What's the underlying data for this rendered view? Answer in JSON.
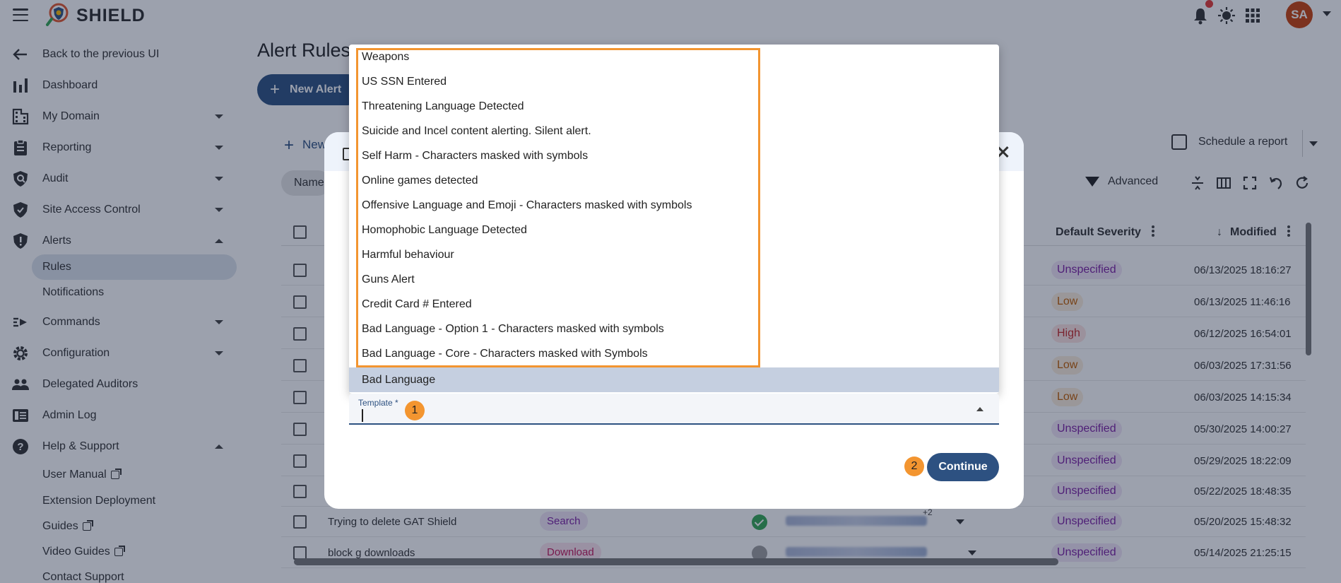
{
  "app": {
    "brand": "SHIELD"
  },
  "user": {
    "initials": "SA"
  },
  "colors": {
    "primary": "#2d5181",
    "accent": "#f39530",
    "avatar": "#c8410c"
  },
  "sidebar": {
    "back": "Back to the previous UI",
    "items": [
      {
        "label": "Dashboard",
        "icon": "bar-chart-icon"
      },
      {
        "label": "My Domain",
        "icon": "building-icon"
      },
      {
        "label": "Reporting",
        "icon": "clipboard-icon"
      },
      {
        "label": "Audit",
        "icon": "magnifier-icon"
      },
      {
        "label": "Site Access Control",
        "icon": "shield-icon"
      },
      {
        "label": "Alerts",
        "icon": "alert-shield-icon"
      },
      {
        "label": "Commands",
        "icon": "commands-icon"
      },
      {
        "label": "Configuration",
        "icon": "gear-icon"
      },
      {
        "label": "Delegated Auditors",
        "icon": "people-icon"
      },
      {
        "label": "Admin Log",
        "icon": "log-icon"
      },
      {
        "label": "Help & Support",
        "icon": "help-icon"
      }
    ],
    "alerts_sub": [
      "Rules",
      "Notifications"
    ],
    "help_sub": [
      "User Manual",
      "Extension Deployment",
      "Guides",
      "Video Guides",
      "Contact Support"
    ]
  },
  "main": {
    "title": "Alert Rules",
    "new_alert_button": "New Alert",
    "new_link": "New",
    "schedule_report": "Schedule a report",
    "filter_chip": "Name",
    "advanced": "Advanced",
    "columns": {
      "severity": "Default Severity",
      "modified": "Modified"
    },
    "rows": [
      {
        "name": "",
        "type": "",
        "severity": "Unspecified",
        "modified": "06/13/2025 18:16:27"
      },
      {
        "name": "",
        "type": "",
        "severity": "Low",
        "modified": "06/13/2025 11:46:16"
      },
      {
        "name": "",
        "type": "",
        "severity": "High",
        "modified": "06/12/2025 16:54:01"
      },
      {
        "name": "",
        "type": "",
        "severity": "Low",
        "modified": "06/03/2025 17:31:56"
      },
      {
        "name": "",
        "type": "",
        "severity": "Low",
        "modified": "06/03/2025 14:15:34"
      },
      {
        "name": "",
        "type": "",
        "severity": "Unspecified",
        "modified": "05/30/2025 14:00:27"
      },
      {
        "name": "",
        "type": "",
        "severity": "Unspecified",
        "modified": "05/29/2025 18:22:09"
      },
      {
        "name": "",
        "type": "",
        "severity": "Unspecified",
        "modified": "05/22/2025 18:48:35"
      },
      {
        "name": "Trying to delete GAT Shield",
        "type": "Search",
        "severity": "Unspecified",
        "modified": "05/20/2025 15:48:32",
        "extra": "+2"
      },
      {
        "name": "block g downloads",
        "type": "Download",
        "severity": "Unspecified",
        "modified": "05/14/2025 21:25:15"
      }
    ]
  },
  "modal": {
    "options": [
      "Weapons",
      "US SSN Entered",
      "Threatening Language Detected",
      "Suicide and Incel content alerting. Silent alert.",
      "Self Harm - Characters masked with symbols",
      "Online games detected",
      "Offensive Language and Emoji - Characters masked with symbols",
      "Homophobic Language Detected",
      "Harmful behaviour",
      "Guns Alert",
      "Credit Card # Entered",
      "Bad Language - Option 1 - Characters masked with symbols",
      "Bad Language - Core - Characters masked with Symbols",
      "Bad Language"
    ],
    "template_label": "Template *",
    "continue": "Continue",
    "badges": [
      "1",
      "2"
    ]
  }
}
